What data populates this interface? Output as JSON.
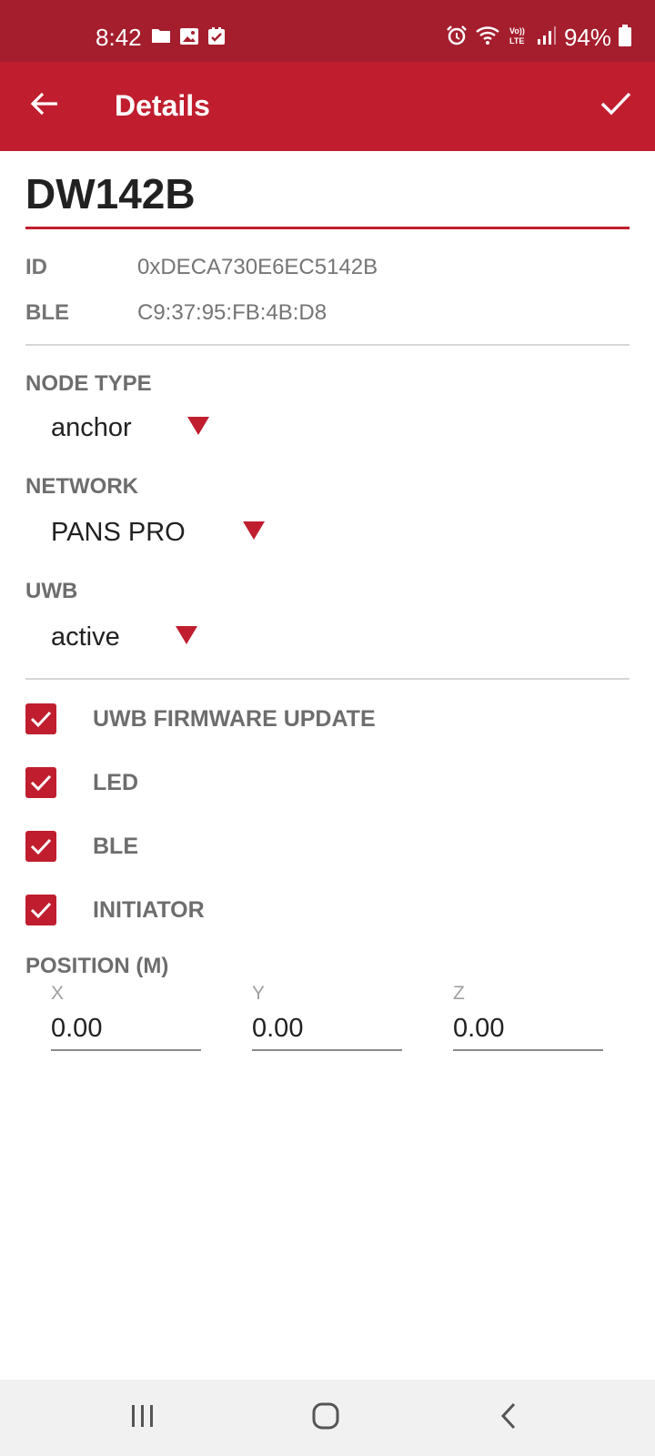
{
  "status_bar": {
    "time": "8:42",
    "battery": "94%",
    "left_icons": [
      "folder-icon",
      "image-icon",
      "checkbox-icon"
    ],
    "right_icons": [
      "alarm-icon",
      "wifi-icon",
      "volte-icon",
      "signal-icon",
      "battery-icon"
    ]
  },
  "app_bar": {
    "title": "Details",
    "back_icon": "arrow-left-icon",
    "confirm_icon": "check-icon",
    "color": "#c01e2e"
  },
  "device": {
    "name": "DW142B",
    "id_label": "ID",
    "id_value": "0xDECA730E6EC5142B",
    "ble_label": "BLE",
    "ble_value": "C9:37:95:FB:4B:D8"
  },
  "node_type": {
    "label": "NODE TYPE",
    "value": "anchor"
  },
  "network": {
    "label": "NETWORK",
    "value": "PANS PRO"
  },
  "uwb": {
    "label": "UWB",
    "value": "active"
  },
  "options": [
    {
      "label": "UWB FIRMWARE UPDATE",
      "checked": true
    },
    {
      "label": "LED",
      "checked": true
    },
    {
      "label": "BLE",
      "checked": true
    },
    {
      "label": "INITIATOR",
      "checked": true
    }
  ],
  "position": {
    "label": "POSITION (M)",
    "x_label": "X",
    "x_value": "0.00",
    "y_label": "Y",
    "y_value": "0.00",
    "z_label": "Z",
    "z_value": "0.00"
  },
  "nav_bar": {
    "icons": [
      "recent-apps-icon",
      "home-icon",
      "back-icon"
    ]
  },
  "colors": {
    "accent": "#c01e2e",
    "status_bar": "#a51e2e",
    "muted_text": "#757575"
  }
}
